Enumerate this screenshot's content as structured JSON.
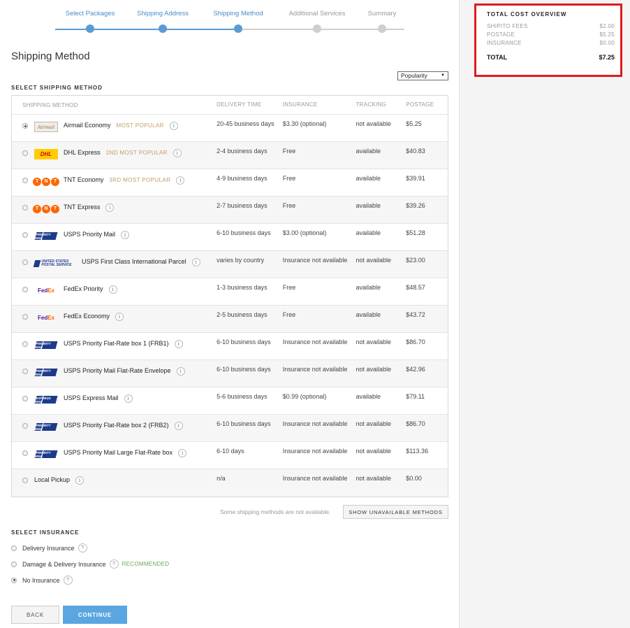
{
  "stepper": {
    "steps": [
      {
        "label": "Select Packages",
        "state": "done"
      },
      {
        "label": "Shipping Address",
        "state": "done"
      },
      {
        "label": "Shipping Method",
        "state": "done"
      },
      {
        "label": "Additional Services",
        "state": "todo"
      },
      {
        "label": "Summary",
        "state": "todo"
      }
    ]
  },
  "page_title": "Shipping Method",
  "sort": {
    "selected": "Popularity"
  },
  "shipping_section_label": "SELECT SHIPPING METHOD",
  "table": {
    "headers": [
      "SHIPPING METHOD",
      "DELIVERY TIME",
      "INSURANCE",
      "TRACKING",
      "POSTAGE"
    ],
    "rows": [
      {
        "logo": "airmail",
        "logo_text": "Airmail",
        "name": "Airmail Economy",
        "badge": "MOST POPULAR",
        "delivery": "20-45 business days",
        "insurance": "$3.30 (optional)",
        "tracking": "not available",
        "postage": "$5.25",
        "selected": true
      },
      {
        "logo": "dhl",
        "logo_text": "DHL",
        "name": "DHL Express",
        "badge": "2ND MOST POPULAR",
        "delivery": "2-4 business days",
        "insurance": "Free",
        "tracking": "available",
        "postage": "$40.83",
        "selected": false
      },
      {
        "logo": "tnt",
        "logo_text": "TNT",
        "name": "TNT Economy",
        "badge": "3RD MOST POPULAR",
        "delivery": "4-9 business days",
        "insurance": "Free",
        "tracking": "available",
        "postage": "$39.91",
        "selected": false
      },
      {
        "logo": "tnt",
        "logo_text": "TNT",
        "name": "TNT Express",
        "badge": "",
        "delivery": "2-7 business days",
        "insurance": "Free",
        "tracking": "available",
        "postage": "$39.26",
        "selected": false
      },
      {
        "logo": "usps",
        "logo_text": "PRIORITY MAIL",
        "name": "USPS Priority Mail",
        "badge": "",
        "delivery": "6-10 business days",
        "insurance": "$3.00 (optional)",
        "tracking": "available",
        "postage": "$51.28",
        "selected": false
      },
      {
        "logo": "usps-wide",
        "logo_text": "UNITED STATES POSTAL SERVICE",
        "name": "USPS First Class International Parcel",
        "badge": "",
        "delivery": "varies by country",
        "insurance": "Insurance not available",
        "tracking": "not available",
        "postage": "$23.00",
        "selected": false
      },
      {
        "logo": "fedex",
        "logo_text": "FedEx",
        "name": "FedEx Priority",
        "badge": "",
        "delivery": "1-3 business days",
        "insurance": "Free",
        "tracking": "available",
        "postage": "$48.57",
        "selected": false
      },
      {
        "logo": "fedex",
        "logo_text": "FedEx",
        "name": "FedEx Economy",
        "badge": "",
        "delivery": "2-5 business days",
        "insurance": "Free",
        "tracking": "available",
        "postage": "$43.72",
        "selected": false
      },
      {
        "logo": "usps",
        "logo_text": "PRIORITY MAIL",
        "name": "USPS Priority Flat-Rate box 1 (FRB1)",
        "badge": "",
        "delivery": "6-10 business days",
        "insurance": "Insurance not available",
        "tracking": "not available",
        "postage": "$86.70",
        "selected": false
      },
      {
        "logo": "usps",
        "logo_text": "PRIORITY MAIL",
        "name": "USPS Priority Mail Flat-Rate Envelope",
        "badge": "",
        "delivery": "6-10 business days",
        "insurance": "Insurance not available",
        "tracking": "not available",
        "postage": "$42.96",
        "selected": false
      },
      {
        "logo": "usps",
        "logo_text": "EXPRESS MAIL",
        "name": "USPS Express Mail",
        "badge": "",
        "delivery": "5-6 business days",
        "insurance": "$0.99 (optional)",
        "tracking": "available",
        "postage": "$79.11",
        "selected": false
      },
      {
        "logo": "usps",
        "logo_text": "PRIORITY MAIL",
        "name": "USPS Priority Flat-Rate box 2 (FRB2)",
        "badge": "",
        "delivery": "6-10 business days",
        "insurance": "Insurance not available",
        "tracking": "not available",
        "postage": "$86.70",
        "selected": false
      },
      {
        "logo": "usps",
        "logo_text": "PRIORITY MAIL",
        "name": "USPS Priority Mail Large Flat-Rate box",
        "badge": "",
        "delivery": "6-10 days",
        "insurance": "Insurance not available",
        "tracking": "not available",
        "postage": "$113.36",
        "selected": false
      },
      {
        "logo": "",
        "logo_text": "",
        "name": "Local Pickup",
        "badge": "",
        "delivery": "n/a",
        "insurance": "Insurance not available",
        "tracking": "not available",
        "postage": "$0.00",
        "selected": false
      }
    ]
  },
  "unavailable_note": "Some shipping methods are not available.",
  "show_unavailable_label": "SHOW UNAVAILABLE METHODS",
  "insurance_section_label": "SELECT INSURANCE",
  "insurance_options": [
    {
      "label": "Delivery Insurance",
      "recommended": "",
      "selected": false
    },
    {
      "label": "Damage & Delivery Insurance",
      "recommended": "RECOMMENDED",
      "selected": false
    },
    {
      "label": "No Insurance",
      "recommended": "",
      "selected": true
    }
  ],
  "buttons": {
    "back": "BACK",
    "continue": "CONTINUE"
  },
  "cost_overview": {
    "title": "TOTAL COST OVERVIEW",
    "lines": [
      {
        "label": "SHIPITO FEES",
        "value": "$2.00"
      },
      {
        "label": "POSTAGE",
        "value": "$5.25"
      },
      {
        "label": "INSURANCE",
        "value": "$0.00"
      }
    ],
    "total_label": "TOTAL",
    "total_value": "$7.25",
    "highlight_color": "#e0191f"
  }
}
